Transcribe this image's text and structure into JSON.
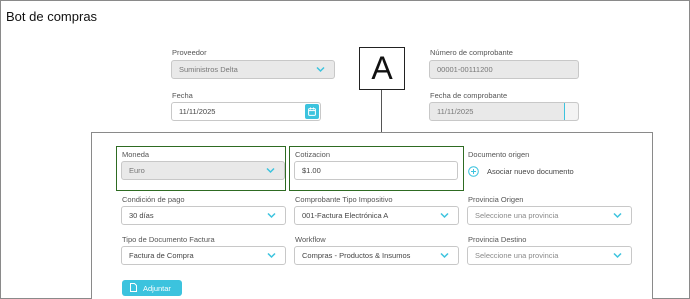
{
  "page": {
    "title": "Bot de compras"
  },
  "callout": {
    "label": "A"
  },
  "header_form": {
    "proveedor": {
      "label": "Proveedor",
      "value": "Suministros Delta"
    },
    "numero": {
      "label": "Número de comprobante",
      "value": "00001-00111200"
    },
    "fecha": {
      "label": "Fecha",
      "value": "11/11/2025"
    },
    "fecha_comprobante": {
      "label": "Fecha de comprobante",
      "value": "11/11/2025"
    }
  },
  "panel": {
    "moneda": {
      "label": "Moneda",
      "value": "Euro"
    },
    "cotizacion": {
      "label": "Cotizacion",
      "value": "$1.00"
    },
    "documento_origen": {
      "label": "Documento origen",
      "link": "Asociar nuevo documento"
    },
    "condicion_pago": {
      "label": "Condición de pago",
      "value": "30 días"
    },
    "comprobante_tipo": {
      "label": "Comprobante Tipo Impositivo",
      "value": "001-Factura Electrónica A"
    },
    "provincia_origen": {
      "label": "Provincia Origen",
      "placeholder": "Seleccione una provincia"
    },
    "tipo_documento": {
      "label": "Tipo de Documento Factura",
      "value": "Factura de Compra"
    },
    "workflow": {
      "label": "Workflow",
      "value": "Compras - Productos & Insumos"
    },
    "provincia_destino": {
      "label": "Provincia Destino",
      "placeholder": "Seleccione una provincia"
    },
    "adjuntar": {
      "label": "Adjuntar"
    }
  },
  "colors": {
    "accent": "#3cc3de",
    "highlight_border": "#2e6b22",
    "disabled_bg": "#e9e9e9"
  },
  "icons": [
    "chevron-down-icon",
    "calendar-icon",
    "plus-circle-icon",
    "document-icon"
  ]
}
